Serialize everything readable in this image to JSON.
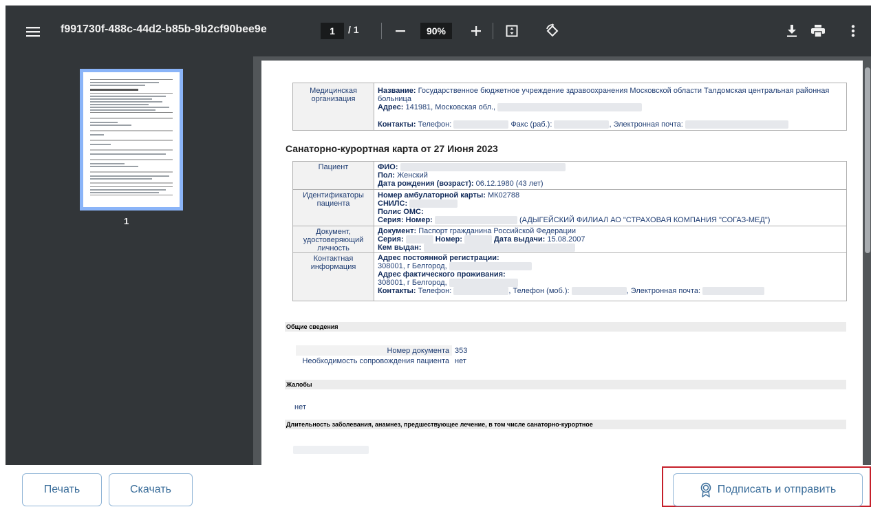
{
  "toolbar": {
    "title": "f991730f-488c-44d2-b85b-9b2cf90bee9e",
    "current_page": "1",
    "page_separator": "/ 1",
    "zoom": "90%"
  },
  "thumbnail": {
    "page_label": "1"
  },
  "document": {
    "org": {
      "label": "Медицинская организация",
      "name_label": "Название:",
      "name_value": "Государственное бюджетное учреждение здравоохранения Московской области Талдомская центральная районная",
      "name_value2": "больница",
      "address_label": "Адрес:",
      "address_value": "141981, Московская обл.,",
      "contacts_label": "Контакты:",
      "contacts_phone": "Телефон:",
      "contacts_fax": "Факс (раб.):",
      "contacts_email": ", Электронная почта:"
    },
    "heading": "Санаторно-курортная карта от 27 Июня 2023",
    "patient": {
      "label": "Пациент",
      "fio_label": "ФИО:",
      "sex_label": "Пол:",
      "sex_value": "Женский",
      "dob_label": "Дата рождения (возраст):",
      "dob_value": "06.12.1980 (43 лет)"
    },
    "ids": {
      "label": "Идентификаторы пациента",
      "card_label": "Номер амбулаторной карты:",
      "card_value": "МК02788",
      "snils_label": "СНИЛС:",
      "oms_label": "Полис ОМС:",
      "series_label": "Серия: Номер:",
      "insurer": "(АДЫГЕЙСКИЙ ФИЛИАЛ АО \"СТРАХОВАЯ КОМПАНИЯ \"СОГАЗ-МЕД\")"
    },
    "id_doc": {
      "label": "Документ, удостоверяющий личность",
      "doc_label": "Документ:",
      "doc_value": "Паспорт гражданина Российской Федерации",
      "series_label": "Серия:",
      "number_label": "Номер:",
      "issue_label": "Дата выдачи:",
      "issue_value": "15.08.2007",
      "issued_by_label": "Кем выдан:"
    },
    "contact": {
      "label": "Контактная информация",
      "reg_label": "Адрес постоянной регистрации:",
      "reg_value": "308001, г Белгород,",
      "fact_label": "Адрес фактического проживания:",
      "fact_value": "308001, г Белгород,",
      "contacts_label": "Контакты:",
      "phone": "Телефон:",
      "mobile": ", Телефон (моб.):",
      "email": ", Электронная почта:"
    },
    "general": {
      "header": "Общие сведения",
      "doc_num_label": "Номер документа",
      "doc_num_value": "353",
      "escort_label": "Необходимость сопровождения пациента",
      "escort_value": "нет"
    },
    "complaints": {
      "header": "Жалобы",
      "value": "нет"
    },
    "history": {
      "header": "Длительность заболевания, анамнез, предшествующее лечение, в том числе санаторно-курортное"
    }
  },
  "footer": {
    "print": "Печать",
    "download": "Скачать",
    "sign_send": "Подписать и отправить"
  },
  "colors": {
    "toolbar_bg": "#323639",
    "viewer_bg": "#525659",
    "accent_border": "#8fb4d6",
    "highlight": "#c51f2a"
  }
}
